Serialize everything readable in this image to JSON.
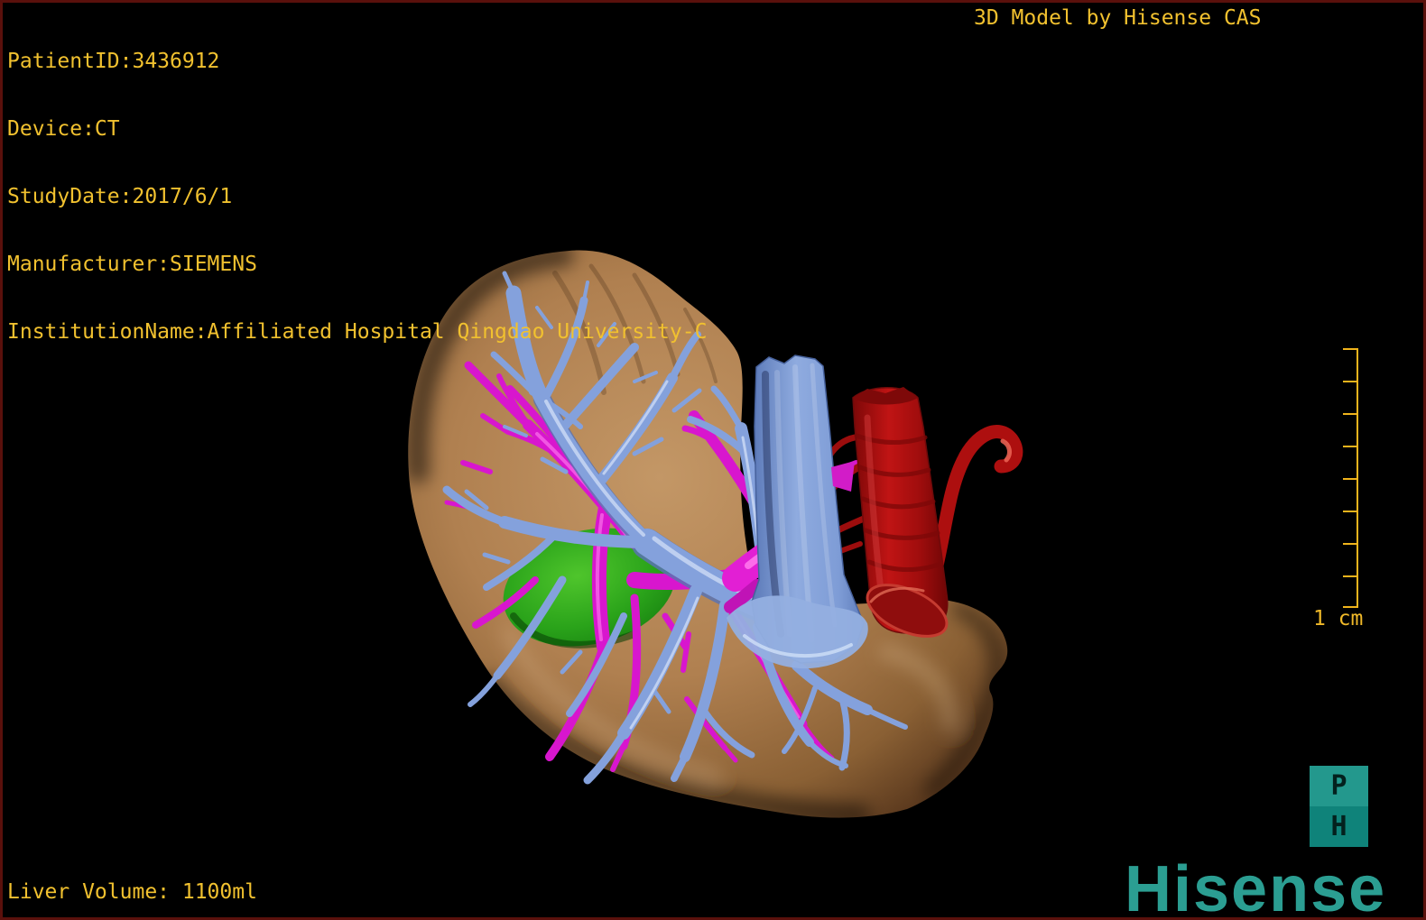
{
  "header": {
    "patient_lines": [
      "PatientID:3436912",
      "Device:CT",
      "StudyDate:2017/6/1",
      "Manufacturer:SIEMENS",
      "InstitutionName:Affiliated Hospital Qingdao University-C"
    ],
    "watermark": "3D Model by Hisense CAS"
  },
  "viewport": {
    "structures": [
      "liver-parenchyma",
      "hepatic-veins-blue",
      "portal-veins-magenta",
      "tumor-green",
      "inferior-vena-cava-blue",
      "aorta-hepatic-artery-red"
    ]
  },
  "scale_bar": {
    "label": "1 cm",
    "tick_count": 9
  },
  "footer": {
    "liver_volume": "Liver Volume: 1100ml"
  },
  "branding": {
    "badge_top": "P",
    "badge_bottom": "H",
    "logo_text": "Hisense"
  },
  "colors": {
    "annotation_text": "#f1c12f",
    "scale_bar": "#f0b41c",
    "brand_teal": "#2b9e92",
    "badge_top_bg": "#23988d",
    "badge_bottom_bg": "#0f837a",
    "frame_border": "#5a100c",
    "liver": "#b08050",
    "hepatic_vein": "#84a1dc",
    "portal_vein": "#d816ce",
    "tumor": "#2aa31a",
    "artery": "#a90f0f"
  }
}
